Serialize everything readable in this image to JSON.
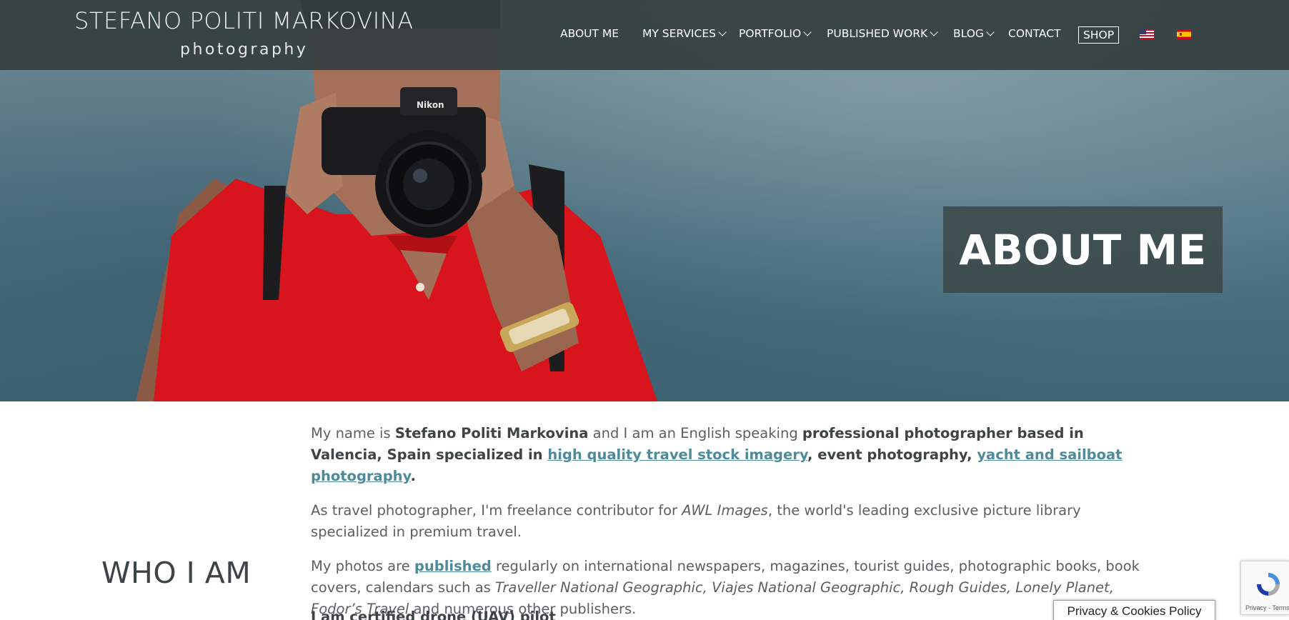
{
  "header": {
    "logo_title": "STEFANO POLITI MARKOVINA",
    "logo_subtitle": "photography",
    "nav": [
      {
        "label": "ABOUT ME",
        "has_dropdown": false
      },
      {
        "label": "MY SERVICES",
        "has_dropdown": true
      },
      {
        "label": "PORTFOLIO",
        "has_dropdown": true
      },
      {
        "label": "PUBLISHED WORK",
        "has_dropdown": true
      },
      {
        "label": "BLOG",
        "has_dropdown": true
      },
      {
        "label": "CONTACT",
        "has_dropdown": false
      }
    ],
    "shop_label": "SHOP",
    "flags": [
      "us-flag-icon",
      "spain-flag-icon"
    ]
  },
  "hero": {
    "title": "ABOUT ME",
    "camera_brand": "Nikon"
  },
  "section": {
    "heading": "WHO I AM",
    "p1": {
      "t1": "My name is ",
      "b1": "Stefano Politi Markovina",
      "t2": " and I am an English speaking ",
      "b2": "professional photographer based in Valencia, Spain specialized in ",
      "link1": "high quality travel stock imagery",
      "b3": ", event photography, ",
      "link2": "yacht and sailboat photography",
      "b4": "."
    },
    "p2": {
      "t1": "As travel photographer, I'm freelance contributor for ",
      "i1": "AWL Images",
      "t2": ", the world's leading exclusive picture library specialized in premium travel."
    },
    "p3": {
      "t1": "My photos are ",
      "link1": "published",
      "t2": " regularly on international newspapers, magazines, tourist guides, photographic books, book covers, calendars such as ",
      "i1": "Traveller National Geographic, Viajes National Geographic, Rough Guides, Lonely Planet, Fodor’s Travel",
      "t3": " and numerous other publishers."
    },
    "partial_line": "I am certified drone (UAV) pilot"
  },
  "privacy_label": "Privacy & Cookies Policy",
  "recaptcha_label": "Privacy - Terms",
  "colors": {
    "header_bg": "#343e40",
    "link": "#4f8a9b",
    "shirt": "#d8141c",
    "hero_box": "#3c4848"
  }
}
